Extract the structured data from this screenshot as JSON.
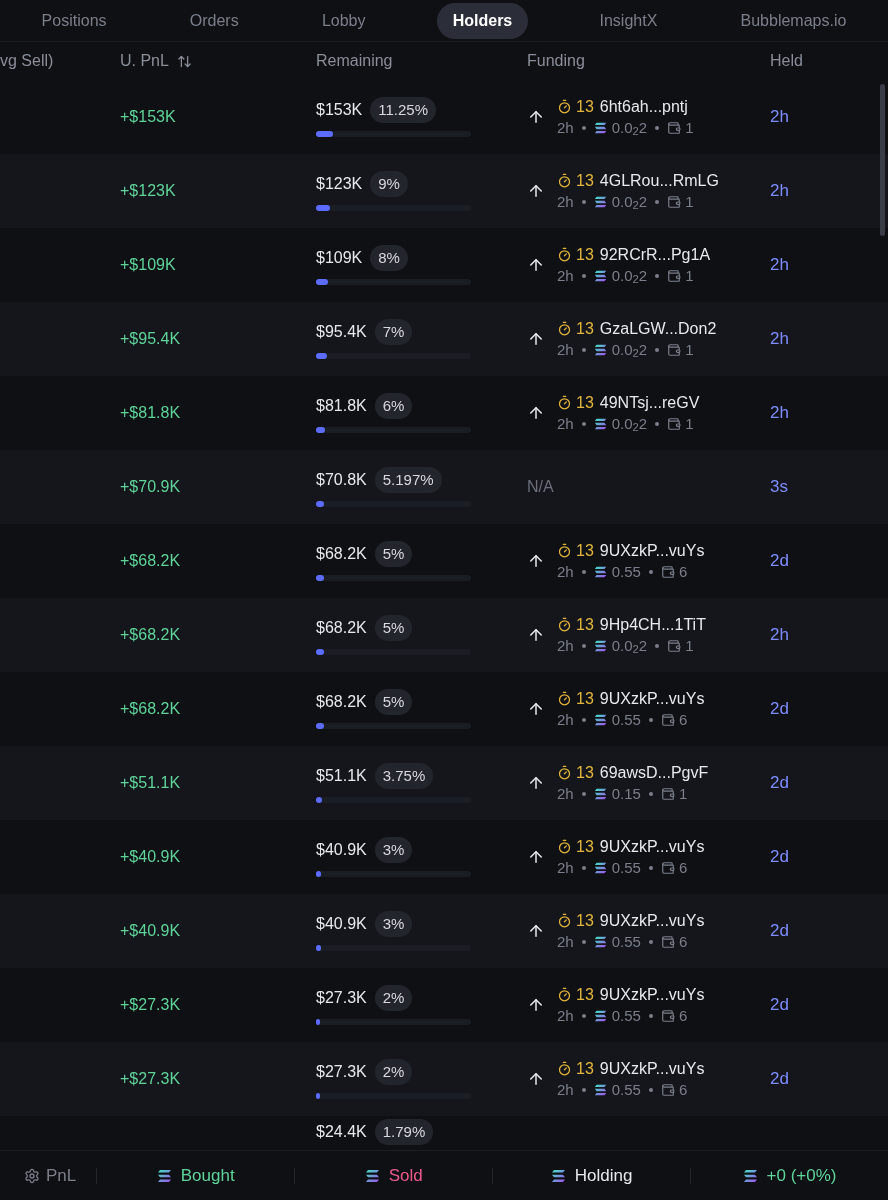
{
  "tabs": [
    {
      "label": "Positions",
      "selected": false
    },
    {
      "label": "Orders",
      "selected": false
    },
    {
      "label": "Lobby",
      "selected": false
    },
    {
      "label": "Holders",
      "selected": true
    },
    {
      "label": "InsightX",
      "selected": false
    },
    {
      "label": "Bubblemaps.io",
      "selected": false
    }
  ],
  "columns": [
    "vg Sell)",
    "U. PnL",
    "Remaining",
    "Funding",
    "Held"
  ],
  "rows": [
    {
      "pnl": "+$153K",
      "remaining": "$153K",
      "pct": "11.25%",
      "level": 0.1125,
      "funding": {
        "kind": "wallet",
        "time": "13",
        "address": "6ht6ah...pntj",
        "age": "2h",
        "amount": "0.0$_{2}$2",
        "wallets": "1"
      },
      "held": "2h"
    },
    {
      "pnl": "+$123K",
      "remaining": "$123K",
      "pct": "9%",
      "level": 0.09,
      "funding": {
        "kind": "wallet",
        "time": "13",
        "address": "4GLRou...RmLG",
        "age": "2h",
        "amount": "0.0$_{2}$2",
        "wallets": "1"
      },
      "held": "2h"
    },
    {
      "pnl": "+$109K",
      "remaining": "$109K",
      "pct": "8%",
      "level": 0.08,
      "funding": {
        "kind": "wallet",
        "time": "13",
        "address": "92RCrR...Pg1A",
        "age": "2h",
        "amount": "0.0$_{2}$2",
        "wallets": "1"
      },
      "held": "2h"
    },
    {
      "pnl": "+$95.4K",
      "remaining": "$95.4K",
      "pct": "7%",
      "level": 0.07,
      "funding": {
        "kind": "wallet",
        "time": "13",
        "address": "GzaLGW...Don2",
        "age": "2h",
        "amount": "0.0$_{2}$2",
        "wallets": "1"
      },
      "held": "2h"
    },
    {
      "pnl": "+$81.8K",
      "remaining": "$81.8K",
      "pct": "6%",
      "level": 0.06,
      "funding": {
        "kind": "wallet",
        "time": "13",
        "address": "49NTsj...reGV",
        "age": "2h",
        "amount": "0.0$_{2}$2",
        "wallets": "1"
      },
      "held": "2h"
    },
    {
      "pnl": "+$70.9K",
      "remaining": "$70.8K",
      "pct": "5.197%",
      "level": 0.052,
      "funding": {
        "kind": "na",
        "text": "N/A"
      },
      "held": "3s"
    },
    {
      "pnl": "+$68.2K",
      "remaining": "$68.2K",
      "pct": "5%",
      "level": 0.05,
      "funding": {
        "kind": "wallet",
        "time": "13",
        "address": "9UXzkP...vuYs",
        "age": "2h",
        "amount": "0.55",
        "wallets": "6"
      },
      "held": "2d"
    },
    {
      "pnl": "+$68.2K",
      "remaining": "$68.2K",
      "pct": "5%",
      "level": 0.05,
      "funding": {
        "kind": "wallet",
        "time": "13",
        "address": "9Hp4CH...1TiT",
        "age": "2h",
        "amount": "0.0$_{2}$2",
        "wallets": "1"
      },
      "held": "2h"
    },
    {
      "pnl": "+$68.2K",
      "remaining": "$68.2K",
      "pct": "5%",
      "level": 0.05,
      "funding": {
        "kind": "wallet",
        "time": "13",
        "address": "9UXzkP...vuYs",
        "age": "2h",
        "amount": "0.55",
        "wallets": "6"
      },
      "held": "2d"
    },
    {
      "pnl": "+$51.1K",
      "remaining": "$51.1K",
      "pct": "3.75%",
      "level": 0.0375,
      "funding": {
        "kind": "wallet",
        "time": "13",
        "address": "69awsD...PgvF",
        "age": "2h",
        "amount": "0.15",
        "wallets": "1"
      },
      "held": "2d"
    },
    {
      "pnl": "+$40.9K",
      "remaining": "$40.9K",
      "pct": "3%",
      "level": 0.03,
      "funding": {
        "kind": "wallet",
        "time": "13",
        "address": "9UXzkP...vuYs",
        "age": "2h",
        "amount": "0.55",
        "wallets": "6"
      },
      "held": "2d"
    },
    {
      "pnl": "+$40.9K",
      "remaining": "$40.9K",
      "pct": "3%",
      "level": 0.03,
      "funding": {
        "kind": "wallet",
        "time": "13",
        "address": "9UXzkP...vuYs",
        "age": "2h",
        "amount": "0.55",
        "wallets": "6"
      },
      "held": "2d"
    },
    {
      "pnl": "+$27.3K",
      "remaining": "$27.3K",
      "pct": "2%",
      "level": 0.02,
      "funding": {
        "kind": "wallet",
        "time": "13",
        "address": "9UXzkP...vuYs",
        "age": "2h",
        "amount": "0.55",
        "wallets": "6"
      },
      "held": "2d"
    },
    {
      "pnl": "+$27.3K",
      "remaining": "$27.3K",
      "pct": "2%",
      "level": 0.02,
      "funding": {
        "kind": "wallet",
        "time": "13",
        "address": "9UXzkP...vuYs",
        "age": "2h",
        "amount": "0.55",
        "wallets": "6"
      },
      "held": "2d"
    }
  ],
  "partial_row": {
    "remaining": "$24.4K",
    "pct": "1.79%"
  },
  "footer": {
    "pnl_label": "PnL",
    "bought": "Bought",
    "sold": "Sold",
    "holding": "Holding",
    "total": "+0 (+0%)"
  }
}
